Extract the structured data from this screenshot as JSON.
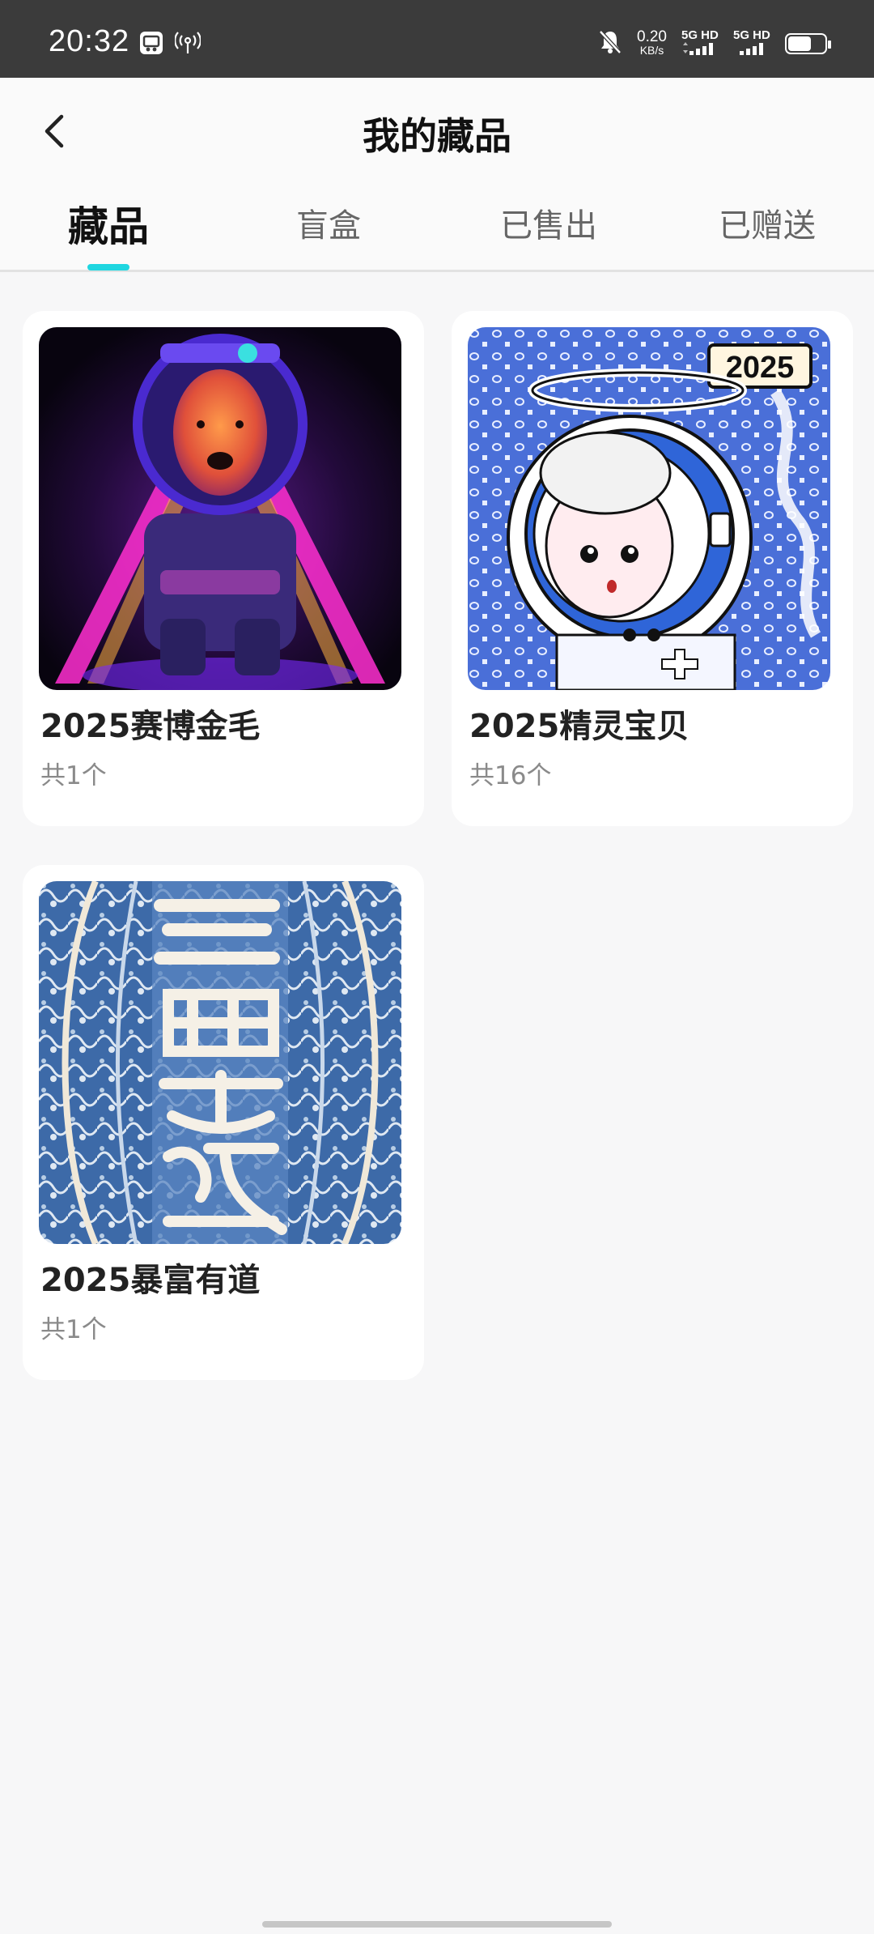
{
  "status_bar": {
    "time": "20:32",
    "net_speed_value": "0.20",
    "net_speed_unit": "KB/s",
    "sim1_label": "5G HD",
    "sim2_label": "5G HD",
    "icons": [
      "notification-app-icon",
      "hotspot-icon",
      "mute-bell-icon",
      "signal-icon",
      "battery-icon"
    ]
  },
  "header": {
    "title": "我的藏品",
    "back_icon": "chevron-left-icon"
  },
  "tabs": [
    {
      "label": "藏品",
      "active": true
    },
    {
      "label": "盲盒",
      "active": false
    },
    {
      "label": "已售出",
      "active": false
    },
    {
      "label": "已赠送",
      "active": false
    }
  ],
  "collections": [
    {
      "title": "2025赛博金毛",
      "count": "共1个",
      "image": "cyber-golden-retriever-astronaut"
    },
    {
      "title": "2025精灵宝贝",
      "count": "共16个",
      "image": "angel-girl-astronaut-2025",
      "image_badge": "2025"
    },
    {
      "title": "2025暴富有道",
      "count": "共1个",
      "image": "blue-calligraphy-pattern"
    }
  ],
  "colors": {
    "accent": "#1fd6e0",
    "status_bar": "#3b3b3b",
    "background": "#f7f7f8"
  }
}
